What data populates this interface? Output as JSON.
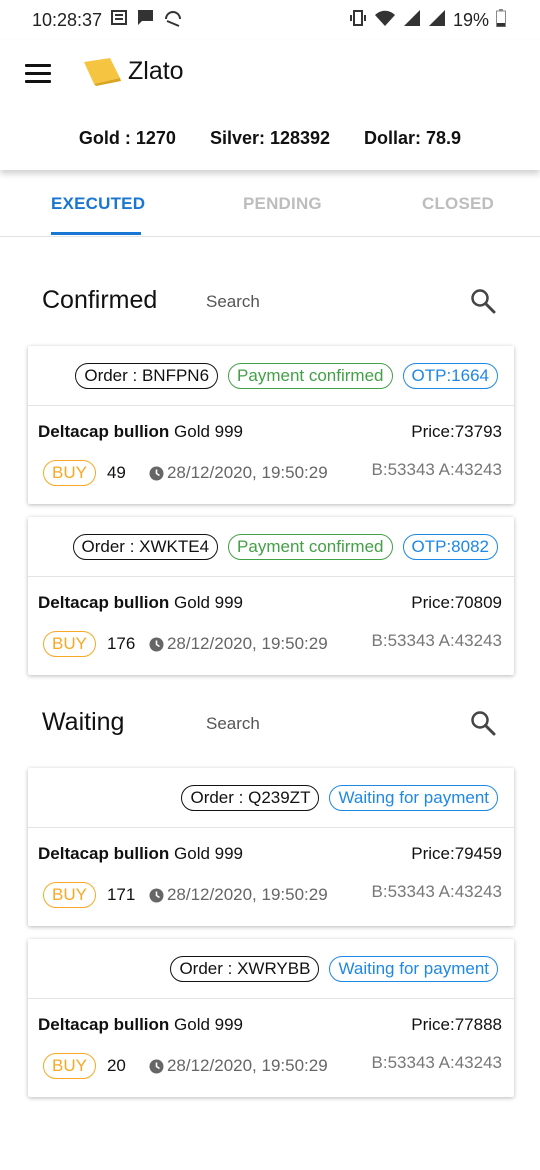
{
  "status_bar": {
    "time": "10:28:37",
    "battery": "19%",
    "icons": [
      "notification-icon",
      "message-icon",
      "headset-icon",
      "vibrate-icon",
      "wifi-icon",
      "signal-icon",
      "signal-icon",
      "battery-icon"
    ]
  },
  "app": {
    "title": "Zlato",
    "logo_color": "#f5c542"
  },
  "rates": {
    "gold": "Gold : 1270",
    "silver": "Silver: 128392",
    "dollar": "Dollar: 78.9"
  },
  "tabs": [
    {
      "label": "EXECUTED",
      "active": true
    },
    {
      "label": "PENDING",
      "active": false
    },
    {
      "label": "CLOSED",
      "active": false
    }
  ],
  "confirmed": {
    "title": "Confirmed",
    "search_label": "Search",
    "cards": [
      {
        "order": "Order : BNFPN6",
        "status": "Payment confirmed",
        "otp": "OTP:1664",
        "name_bold": "Deltacap bullion",
        "name_rest": " Gold 999",
        "price": "Price:73793",
        "side": "BUY",
        "qty": "49",
        "datetime": "28/12/2020, 19:50:29",
        "bid_ask": "B:53343 A:43243"
      },
      {
        "order": "Order : XWKTE4",
        "status": "Payment confirmed",
        "otp": "OTP:8082",
        "name_bold": "Deltacap bullion",
        "name_rest": " Gold 999",
        "price": "Price:70809",
        "side": "BUY",
        "qty": "176",
        "datetime": "28/12/2020, 19:50:29",
        "bid_ask": "B:53343 A:43243"
      }
    ]
  },
  "waiting": {
    "title": "Waiting",
    "search_label": "Search",
    "cards": [
      {
        "order": "Order : Q239ZT",
        "status": "Waiting for payment",
        "name_bold": "Deltacap bullion",
        "name_rest": " Gold 999",
        "price": "Price:79459",
        "side": "BUY",
        "qty": "171",
        "datetime": "28/12/2020, 19:50:29",
        "bid_ask": "B:53343 A:43243"
      },
      {
        "order": "Order : XWRYBB",
        "status": "Waiting for payment",
        "name_bold": "Deltacap bullion",
        "name_rest": " Gold 999",
        "price": "Price:77888",
        "side": "BUY",
        "qty": "20",
        "datetime": "28/12/2020, 19:50:29",
        "bid_ask": "B:53343 A:43243"
      }
    ]
  },
  "colors": {
    "accent": "#1976d2",
    "confirmed": "#43a047",
    "otp": "#1e88e5",
    "buy": "#f9a825"
  }
}
